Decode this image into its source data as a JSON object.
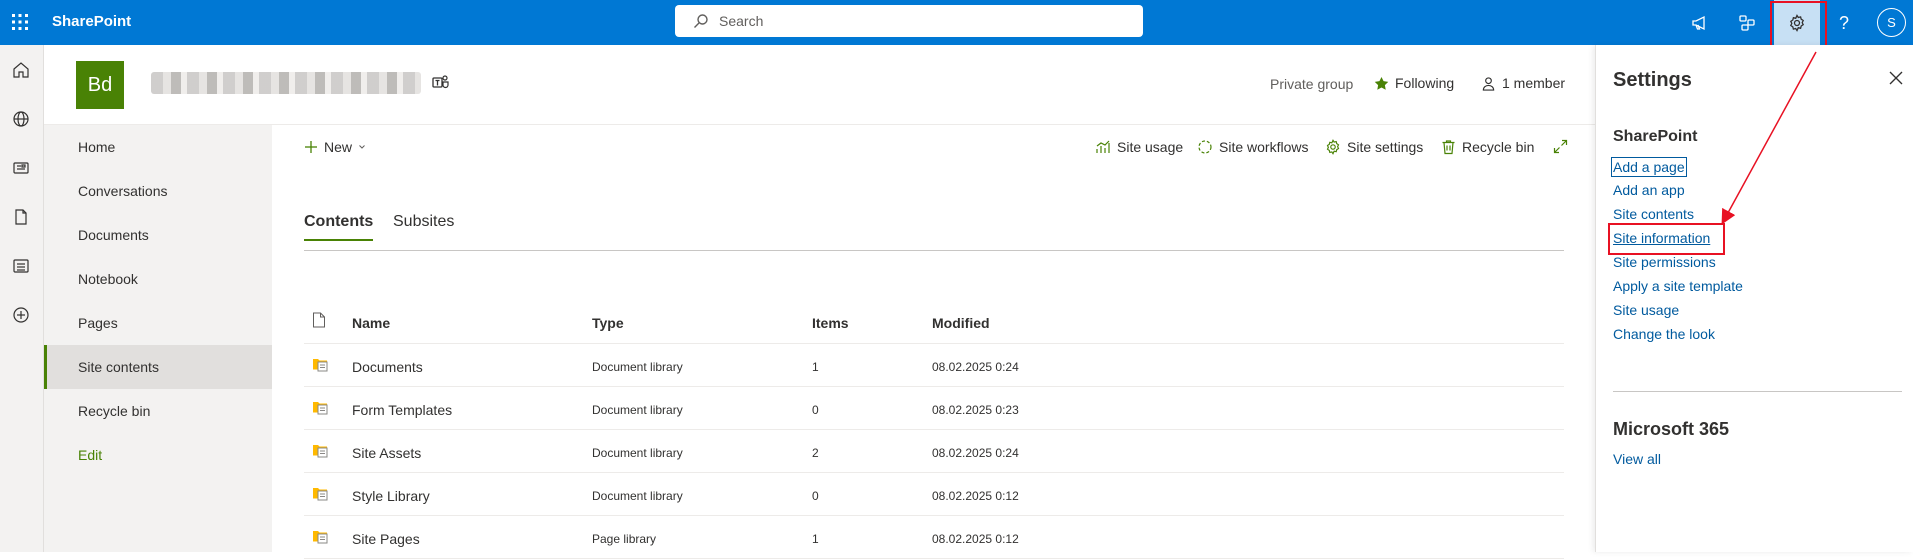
{
  "topbar": {
    "brand": "SharePoint",
    "search_placeholder": "Search",
    "help_label": "?",
    "user_initial": "S"
  },
  "site": {
    "logo_initials": "Bd",
    "privacy": "Private group",
    "follow_label": "Following",
    "members_label": "1 member"
  },
  "quicklaunch": {
    "items": [
      {
        "label": "Home"
      },
      {
        "label": "Conversations"
      },
      {
        "label": "Documents"
      },
      {
        "label": "Notebook"
      },
      {
        "label": "Pages"
      },
      {
        "label": "Site contents"
      },
      {
        "label": "Recycle bin"
      },
      {
        "label": "Edit"
      }
    ]
  },
  "commandbar": {
    "new_label": "New",
    "site_usage": "Site usage",
    "site_workflows": "Site workflows",
    "site_settings": "Site settings",
    "recycle_bin": "Recycle bin"
  },
  "tabs": [
    {
      "label": "Contents"
    },
    {
      "label": "Subsites"
    }
  ],
  "table": {
    "headers": {
      "name": "Name",
      "type": "Type",
      "items": "Items",
      "modified": "Modified"
    },
    "rows": [
      {
        "name": "Documents",
        "type": "Document library",
        "items": "1",
        "modified": "08.02.2025 0:24"
      },
      {
        "name": "Form Templates",
        "type": "Document library",
        "items": "0",
        "modified": "08.02.2025 0:23"
      },
      {
        "name": "Site Assets",
        "type": "Document library",
        "items": "2",
        "modified": "08.02.2025 0:24"
      },
      {
        "name": "Style Library",
        "type": "Document library",
        "items": "0",
        "modified": "08.02.2025 0:12"
      },
      {
        "name": "Site Pages",
        "type": "Page library",
        "items": "1",
        "modified": "08.02.2025 0:12"
      }
    ]
  },
  "settings": {
    "title": "Settings",
    "sharepoint_heading": "SharePoint",
    "links": [
      {
        "label": "Add a page"
      },
      {
        "label": "Add an app"
      },
      {
        "label": "Site contents"
      },
      {
        "label": "Site information"
      },
      {
        "label": "Site permissions"
      },
      {
        "label": "Apply a site template"
      },
      {
        "label": "Site usage"
      },
      {
        "label": "Change the look"
      }
    ],
    "m365_heading": "Microsoft 365",
    "view_all": "View all"
  },
  "colors": {
    "suite_bar": "#0078d4",
    "site_accent": "#498205",
    "link": "#005a9e",
    "annotation": "#e81123"
  }
}
